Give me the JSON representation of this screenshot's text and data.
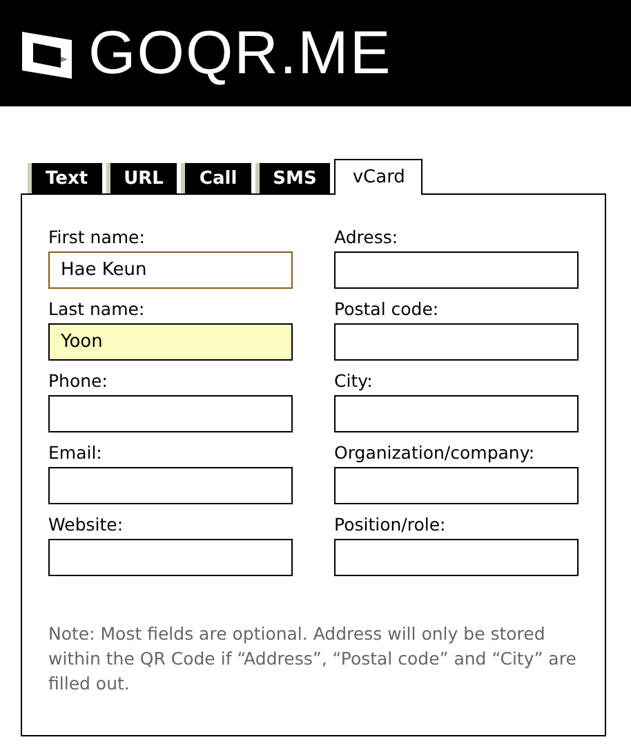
{
  "logo": {
    "text": "GO**QR**.ME"
  },
  "tabs": [
    {
      "label": "Text",
      "selected": false
    },
    {
      "label": "URL",
      "selected": false
    },
    {
      "label": "Call",
      "selected": false
    },
    {
      "label": "SMS",
      "selected": false
    },
    {
      "label": "vCard",
      "selected": true
    }
  ],
  "fields": [
    {
      "label": "First name:",
      "value": "Hae Keun",
      "focused": true,
      "highlighted": false
    },
    {
      "label": "Adress:",
      "focused": false,
      "highlighted": false
    },
    {
      "label": "Last name:",
      "value": "Yoon",
      "focused": false,
      "highlighted": true
    },
    {
      "label": "Postal code:",
      "focused": false,
      "highlighted": false
    },
    {
      "label": "Phone:",
      "focused": false,
      "highlighted": false
    },
    {
      "label": "City:",
      "focused": false,
      "highlighted": false
    },
    {
      "label": "Email:",
      "focused": false,
      "highlighted": false
    },
    {
      "label": "Organization/company:",
      "focused": false,
      "highlighted": false
    },
    {
      "label": "Website:",
      "focused": false,
      "highlighted": false
    },
    {
      "label": "Position/role:",
      "focused": false,
      "highlighted": false
    }
  ],
  "note": "Note: Most fields are optional. Address will only be stored within the QR Code if “Address”, “Postal code” and “City” are filled out."
}
